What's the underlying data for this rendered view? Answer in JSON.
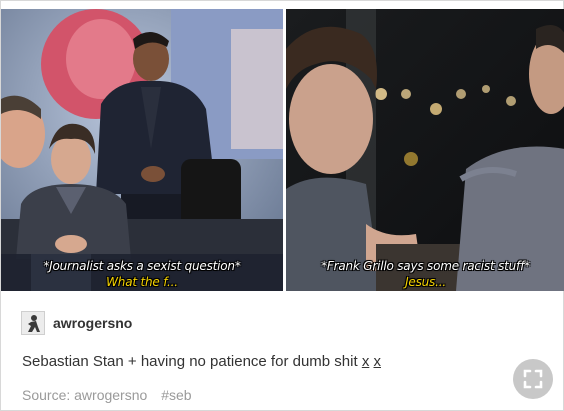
{
  "left_gif": {
    "caption_line1": "*Journalist asks a sexist question*",
    "caption_line2": "What the f..."
  },
  "right_gif": {
    "caption_line1": "*Frank Grillo says some racist stuff*",
    "caption_line2": "Jesus..."
  },
  "post": {
    "username": "awrogersno",
    "body_main": "Sebastian Stan + having no patience for dumb shit ",
    "body_link1": "x",
    "body_link2": "x",
    "source_label": "Source: awrogersno",
    "tag": "#seb"
  },
  "icons": {
    "avatar": "avatar-image",
    "expand": "expand-icon"
  },
  "colors": {
    "caption_white": "#ffffff",
    "caption_yellow": "#f4d200",
    "text": "#333333",
    "muted": "#9a9a9a",
    "button": "#c8c8c8"
  }
}
